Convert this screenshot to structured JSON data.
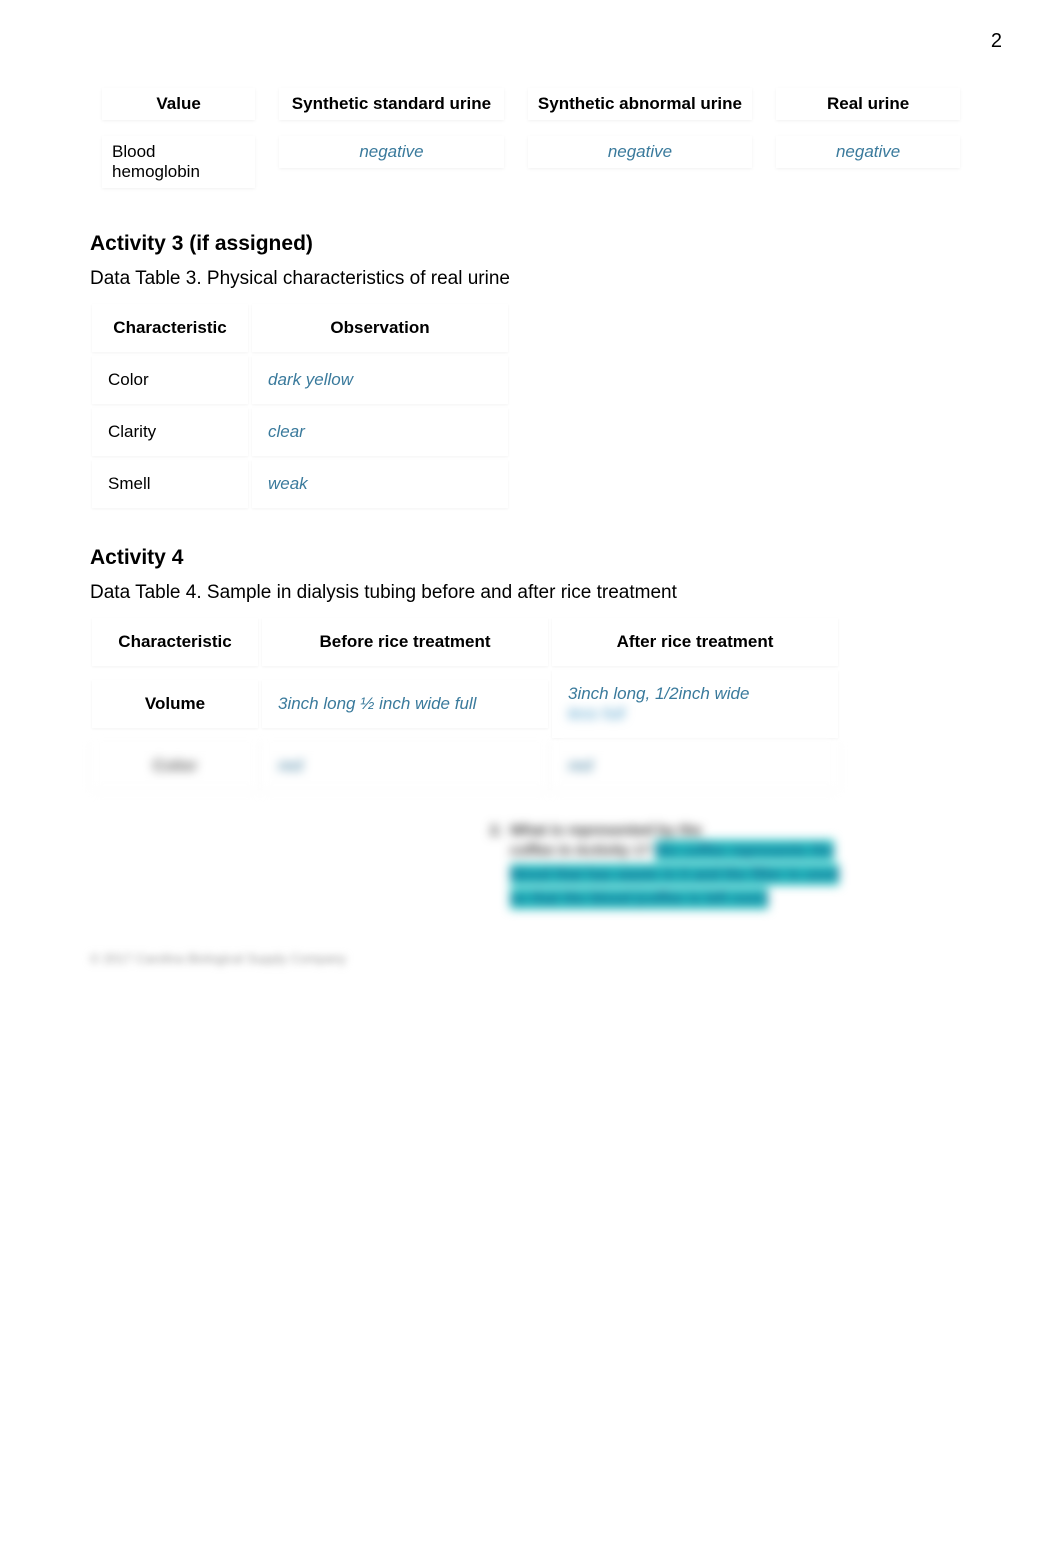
{
  "page_number": "2",
  "table1": {
    "headers": [
      "Value",
      "Synthetic standard urine",
      "Synthetic abnormal urine",
      "Real urine"
    ],
    "row": {
      "label": "Blood hemoglobin",
      "values": [
        "negative",
        "negative",
        "negative"
      ]
    }
  },
  "activity3": {
    "heading": "Activity 3 (if assigned)",
    "caption": "Data Table 3. Physical characteristics of real urine",
    "headers": [
      "Characteristic",
      "Observation"
    ],
    "rows": [
      {
        "label": "Color",
        "value": "dark yellow"
      },
      {
        "label": "Clarity",
        "value": "clear"
      },
      {
        "label": "Smell",
        "value": "weak"
      }
    ]
  },
  "activity4": {
    "heading": "Activity 4",
    "caption": "Data Table 4. Sample in dialysis tubing before and after rice treatment",
    "headers": [
      "Characteristic",
      "Before rice treatment",
      "After rice treatment"
    ],
    "rows": [
      {
        "label": "Volume",
        "before": "3inch long ½ inch wide full",
        "after": "3inch long, 1/2inch wide",
        "after_blur": "less full"
      },
      {
        "label_blur": "Color",
        "before_blur": "red",
        "after_blur": "red"
      }
    ]
  },
  "question": {
    "number": "2.",
    "first_line": "What is represented by the",
    "line2_prefix": "coffee in Activity 1? ",
    "highlighted": "the coffee represents the blood that has waste in it and the filter is used so that the blood (coffee is left over)"
  },
  "copyright": "© 2017 Carolina Biological Supply Company"
}
